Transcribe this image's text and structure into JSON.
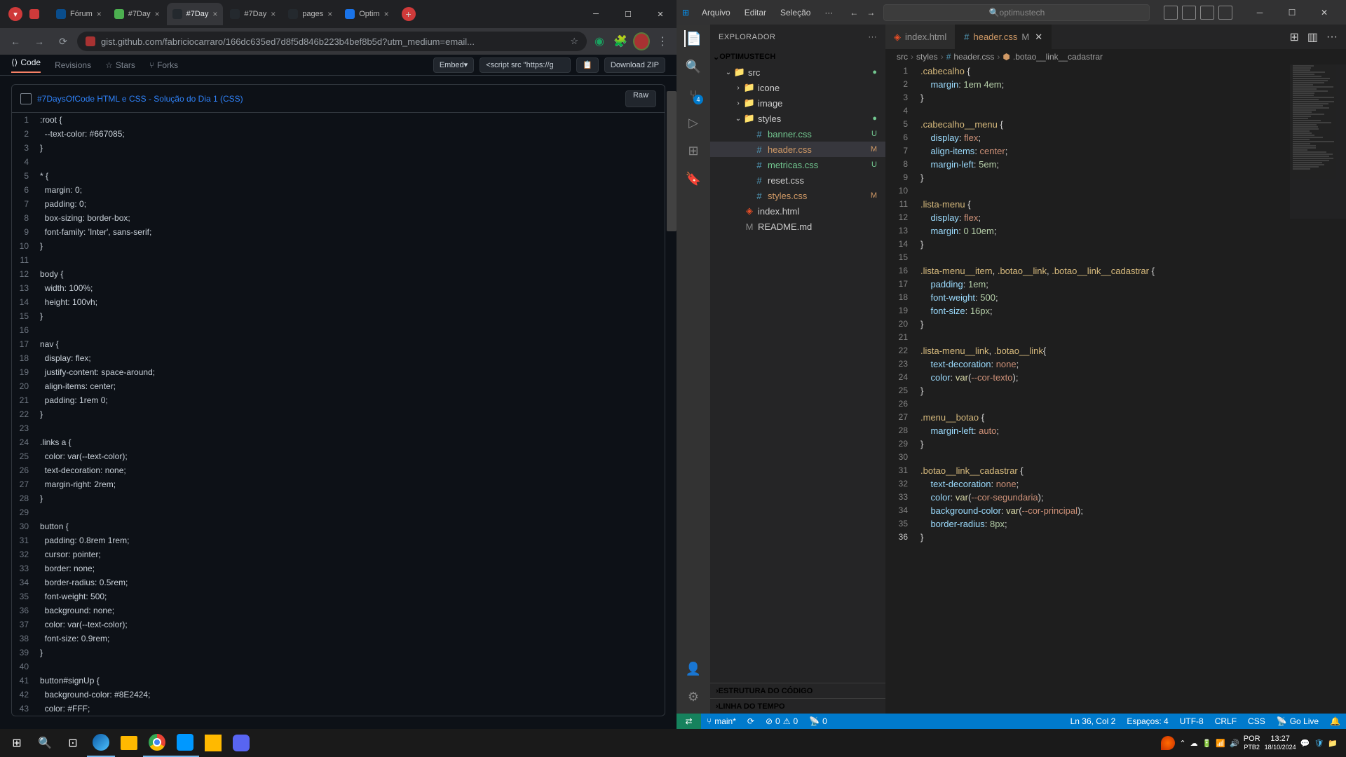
{
  "browser": {
    "tabs": [
      {
        "label": "",
        "fav": "#cf3a3a"
      },
      {
        "label": "Fórum",
        "fav": "#0a4d8c",
        "close": "×"
      },
      {
        "label": "#7Day",
        "fav": "#4caf50",
        "close": "×"
      },
      {
        "label": "#7Day",
        "fav": "#24292e",
        "close": "×",
        "active": true
      },
      {
        "label": "#7Day",
        "fav": "#24292e",
        "close": "×"
      },
      {
        "label": "pages",
        "fav": "#24292e",
        "close": "×"
      },
      {
        "label": "Optim",
        "fav": "#1a73e8",
        "close": "×"
      }
    ],
    "url": "gist.github.com/fabriciocarraro/166dc635ed7d8f5d846b223b4bef8b5d?utm_medium=email...",
    "toolbar": {
      "code": "Code",
      "revisions": "Revisions",
      "stars": "Stars",
      "forks": "Forks",
      "embed": "Embed",
      "script": "<script src  \"https://g",
      "download": "Download ZIP"
    },
    "file": {
      "name": "#7DaysOfCode HTML e CSS - Solução do Dia 1 (CSS)",
      "raw": "Raw"
    },
    "code_lines": [
      ":root {",
      "  --text-color: #667085;",
      "}",
      "",
      "* {",
      "  margin: 0;",
      "  padding: 0;",
      "  box-sizing: border-box;",
      "  font-family: 'Inter', sans-serif;",
      "}",
      "",
      "body {",
      "  width: 100%;",
      "  height: 100vh;",
      "}",
      "",
      "nav {",
      "  display: flex;",
      "  justify-content: space-around;",
      "  align-items: center;",
      "  padding: 1rem 0;",
      "}",
      "",
      ".links a {",
      "  color: var(--text-color);",
      "  text-decoration: none;",
      "  margin-right: 2rem;",
      "}",
      "",
      "button {",
      "  padding: 0.8rem 1rem;",
      "  cursor: pointer;",
      "  border: none;",
      "  border-radius: 0.5rem;",
      "  font-weight: 500;",
      "  background: none;",
      "  color: var(--text-color);",
      "  font-size: 0.9rem;",
      "}",
      "",
      "button#signUp {",
      "  background-color: #8E2424;",
      "  color: #FFF;"
    ]
  },
  "vscode": {
    "menu": [
      "Arquivo",
      "Editar",
      "Seleção",
      "···"
    ],
    "search": "optimustech",
    "explorer_title": "EXPLORADOR",
    "project": "OPTIMUSTECH",
    "tree": [
      {
        "type": "folder",
        "name": "src",
        "depth": 1,
        "open": true,
        "dot": true
      },
      {
        "type": "folder",
        "name": "icone",
        "depth": 2
      },
      {
        "type": "folder",
        "name": "image",
        "depth": 2
      },
      {
        "type": "folder",
        "name": "styles",
        "depth": 2,
        "open": true,
        "dot": true
      },
      {
        "type": "file",
        "name": "banner.css",
        "depth": 3,
        "icon": "css",
        "badge": "U",
        "bc": "git-u"
      },
      {
        "type": "file",
        "name": "header.css",
        "depth": 3,
        "icon": "css",
        "badge": "M",
        "bc": "git-m",
        "selected": true
      },
      {
        "type": "file",
        "name": "metricas.css",
        "depth": 3,
        "icon": "css",
        "badge": "U",
        "bc": "git-u"
      },
      {
        "type": "file",
        "name": "reset.css",
        "depth": 3,
        "icon": "css"
      },
      {
        "type": "file",
        "name": "styles.css",
        "depth": 3,
        "icon": "css",
        "badge": "M",
        "bc": "git-m"
      },
      {
        "type": "file",
        "name": "index.html",
        "depth": 2,
        "icon": "html"
      },
      {
        "type": "file",
        "name": "README.md",
        "depth": 2,
        "icon": "md"
      }
    ],
    "outline": "ESTRUTURA DO CÓDIGO",
    "timeline": "LINHA DO TEMPO",
    "tabs": [
      {
        "name": "index.html",
        "icon": "html"
      },
      {
        "name": "header.css",
        "icon": "css",
        "mod": "M",
        "active": true,
        "close": true
      }
    ],
    "breadcrumb": [
      "src",
      "styles",
      "header.css",
      ".botao__link__cadastrar"
    ],
    "editor_tokens": [
      [
        {
          "t": "sel",
          "v": ".cabecalho "
        },
        {
          "t": "punc",
          "v": "{"
        }
      ],
      [
        {
          "t": "punc",
          "v": "    "
        },
        {
          "t": "prop",
          "v": "margin"
        },
        {
          "t": "punc",
          "v": ": "
        },
        {
          "t": "num",
          "v": "1em 4em"
        },
        {
          "t": "punc",
          "v": ";"
        }
      ],
      [
        {
          "t": "punc",
          "v": "}"
        }
      ],
      [],
      [
        {
          "t": "sel",
          "v": ".cabecalho__menu "
        },
        {
          "t": "punc",
          "v": "{"
        }
      ],
      [
        {
          "t": "punc",
          "v": "    "
        },
        {
          "t": "prop",
          "v": "display"
        },
        {
          "t": "punc",
          "v": ": "
        },
        {
          "t": "val",
          "v": "flex"
        },
        {
          "t": "punc",
          "v": ";"
        }
      ],
      [
        {
          "t": "punc",
          "v": "    "
        },
        {
          "t": "prop",
          "v": "align-items"
        },
        {
          "t": "punc",
          "v": ": "
        },
        {
          "t": "val",
          "v": "center"
        },
        {
          "t": "punc",
          "v": ";"
        }
      ],
      [
        {
          "t": "punc",
          "v": "    "
        },
        {
          "t": "prop",
          "v": "margin-left"
        },
        {
          "t": "punc",
          "v": ": "
        },
        {
          "t": "num",
          "v": "5em"
        },
        {
          "t": "punc",
          "v": ";"
        }
      ],
      [
        {
          "t": "punc",
          "v": "}"
        }
      ],
      [],
      [
        {
          "t": "sel",
          "v": ".lista-menu "
        },
        {
          "t": "punc",
          "v": "{"
        }
      ],
      [
        {
          "t": "punc",
          "v": "    "
        },
        {
          "t": "prop",
          "v": "display"
        },
        {
          "t": "punc",
          "v": ": "
        },
        {
          "t": "val",
          "v": "flex"
        },
        {
          "t": "punc",
          "v": ";"
        }
      ],
      [
        {
          "t": "punc",
          "v": "    "
        },
        {
          "t": "prop",
          "v": "margin"
        },
        {
          "t": "punc",
          "v": ": "
        },
        {
          "t": "num",
          "v": "0 10em"
        },
        {
          "t": "punc",
          "v": ";"
        }
      ],
      [
        {
          "t": "punc",
          "v": "}"
        }
      ],
      [],
      [
        {
          "t": "sel",
          "v": ".lista-menu__item"
        },
        {
          "t": "punc",
          "v": ", "
        },
        {
          "t": "sel",
          "v": ".botao__link"
        },
        {
          "t": "punc",
          "v": ", "
        },
        {
          "t": "sel",
          "v": ".botao__link__cadastrar "
        },
        {
          "t": "punc",
          "v": "{"
        }
      ],
      [
        {
          "t": "punc",
          "v": "    "
        },
        {
          "t": "prop",
          "v": "padding"
        },
        {
          "t": "punc",
          "v": ": "
        },
        {
          "t": "num",
          "v": "1em"
        },
        {
          "t": "punc",
          "v": ";"
        }
      ],
      [
        {
          "t": "punc",
          "v": "    "
        },
        {
          "t": "prop",
          "v": "font-weight"
        },
        {
          "t": "punc",
          "v": ": "
        },
        {
          "t": "num",
          "v": "500"
        },
        {
          "t": "punc",
          "v": ";"
        }
      ],
      [
        {
          "t": "punc",
          "v": "    "
        },
        {
          "t": "prop",
          "v": "font-size"
        },
        {
          "t": "punc",
          "v": ": "
        },
        {
          "t": "num",
          "v": "16px"
        },
        {
          "t": "punc",
          "v": ";"
        }
      ],
      [
        {
          "t": "punc",
          "v": "}"
        }
      ],
      [],
      [
        {
          "t": "sel",
          "v": ".lista-menu__link"
        },
        {
          "t": "punc",
          "v": ", "
        },
        {
          "t": "sel",
          "v": ".botao__link"
        },
        {
          "t": "punc",
          "v": "{"
        }
      ],
      [
        {
          "t": "punc",
          "v": "    "
        },
        {
          "t": "prop",
          "v": "text-decoration"
        },
        {
          "t": "punc",
          "v": ": "
        },
        {
          "t": "val",
          "v": "none"
        },
        {
          "t": "punc",
          "v": ";"
        }
      ],
      [
        {
          "t": "punc",
          "v": "    "
        },
        {
          "t": "prop",
          "v": "color"
        },
        {
          "t": "punc",
          "v": ": "
        },
        {
          "t": "func",
          "v": "var"
        },
        {
          "t": "punc",
          "v": "("
        },
        {
          "t": "val",
          "v": "--cor-texto"
        },
        {
          "t": "punc",
          "v": ");"
        }
      ],
      [
        {
          "t": "punc",
          "v": "}"
        }
      ],
      [],
      [
        {
          "t": "sel",
          "v": ".menu__botao "
        },
        {
          "t": "punc",
          "v": "{"
        }
      ],
      [
        {
          "t": "punc",
          "v": "    "
        },
        {
          "t": "prop",
          "v": "margin-left"
        },
        {
          "t": "punc",
          "v": ": "
        },
        {
          "t": "val",
          "v": "auto"
        },
        {
          "t": "punc",
          "v": ";"
        }
      ],
      [
        {
          "t": "punc",
          "v": "}"
        }
      ],
      [],
      [
        {
          "t": "sel",
          "v": ".botao__link__cadastrar "
        },
        {
          "t": "punc",
          "v": "{"
        }
      ],
      [
        {
          "t": "punc",
          "v": "    "
        },
        {
          "t": "prop",
          "v": "text-decoration"
        },
        {
          "t": "punc",
          "v": ": "
        },
        {
          "t": "val",
          "v": "none"
        },
        {
          "t": "punc",
          "v": ";"
        }
      ],
      [
        {
          "t": "punc",
          "v": "    "
        },
        {
          "t": "prop",
          "v": "color"
        },
        {
          "t": "punc",
          "v": ": "
        },
        {
          "t": "func",
          "v": "var"
        },
        {
          "t": "punc",
          "v": "("
        },
        {
          "t": "val",
          "v": "--cor-segundaria"
        },
        {
          "t": "punc",
          "v": ");"
        }
      ],
      [
        {
          "t": "punc",
          "v": "    "
        },
        {
          "t": "prop",
          "v": "background-color"
        },
        {
          "t": "punc",
          "v": ": "
        },
        {
          "t": "func",
          "v": "var"
        },
        {
          "t": "punc",
          "v": "("
        },
        {
          "t": "val",
          "v": "--cor-principal"
        },
        {
          "t": "punc",
          "v": ");"
        }
      ],
      [
        {
          "t": "punc",
          "v": "    "
        },
        {
          "t": "prop",
          "v": "border-radius"
        },
        {
          "t": "punc",
          "v": ": "
        },
        {
          "t": "num",
          "v": "8px"
        },
        {
          "t": "punc",
          "v": ";"
        }
      ],
      [
        {
          "t": "punc",
          "v": "}"
        }
      ]
    ],
    "status": {
      "branch": "main*",
      "sync": "",
      "errors": "0",
      "warnings": "0",
      "ports": "0",
      "ln": "Ln 36, Col 2",
      "spaces": "Espaços: 4",
      "enc": "UTF-8",
      "eol": "CRLF",
      "lang": "CSS",
      "live": "Go Live",
      "bell": "🔔"
    }
  },
  "taskbar": {
    "time": "13:27",
    "date": "18/10/2024",
    "lang": "POR",
    "kb": "PTB2"
  }
}
